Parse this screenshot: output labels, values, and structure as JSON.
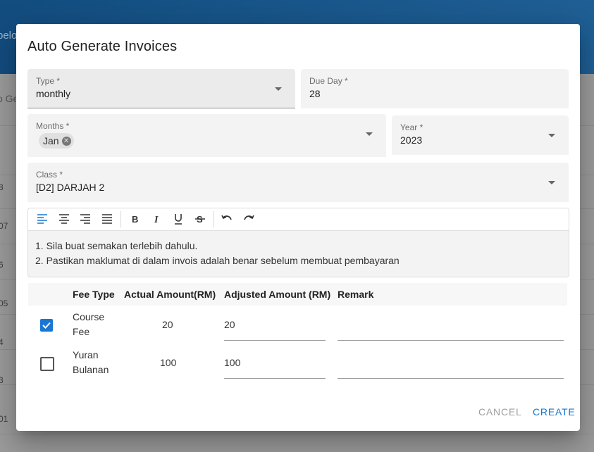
{
  "background": {
    "header_text": "pelo",
    "button_text": "o Ge",
    "row_numbers": [
      "8",
      "07",
      "6",
      "05",
      "4",
      "3",
      "01"
    ]
  },
  "dialog": {
    "title": "Auto Generate Invoices",
    "type": {
      "label": "Type *",
      "value": "monthly"
    },
    "due_day": {
      "label": "Due Day *",
      "value": "28"
    },
    "months": {
      "label": "Months *",
      "chips": [
        "Jan"
      ]
    },
    "year": {
      "label": "Year *",
      "value": "2023"
    },
    "class": {
      "label": "Class *",
      "value": "[D2] DARJAH 2"
    },
    "editor": {
      "toolbar_icons": [
        "align-left-icon",
        "align-center-icon",
        "align-right-icon",
        "align-justify-icon",
        "bold-icon",
        "italic-icon",
        "underline-icon",
        "strikethrough-icon",
        "undo-icon",
        "redo-icon"
      ],
      "active_tool": "align-left-icon",
      "lines": [
        "1. Sila buat semakan terlebih dahulu.",
        "2. Pastikan maklumat di dalam invois adalah benar sebelum membuat pembayaran"
      ]
    },
    "fee_table": {
      "headers": [
        "Fee Type",
        "Actual Amount(RM)",
        "Adjusted Amount (RM)",
        "Remark"
      ],
      "rows": [
        {
          "checked": true,
          "fee_type_line1": "Course",
          "fee_type_line2": "Fee",
          "actual": "20",
          "adjusted": "20",
          "remark": ""
        },
        {
          "checked": false,
          "fee_type_line1": "Yuran",
          "fee_type_line2": "Bulanan",
          "actual": "100",
          "adjusted": "100",
          "remark": ""
        }
      ]
    },
    "actions": {
      "cancel": "CANCEL",
      "create": "CREATE"
    }
  },
  "colors": {
    "primary": "#1976d2",
    "app_bar": "#1a5a8f",
    "muted_action": "#9e9e9e"
  }
}
